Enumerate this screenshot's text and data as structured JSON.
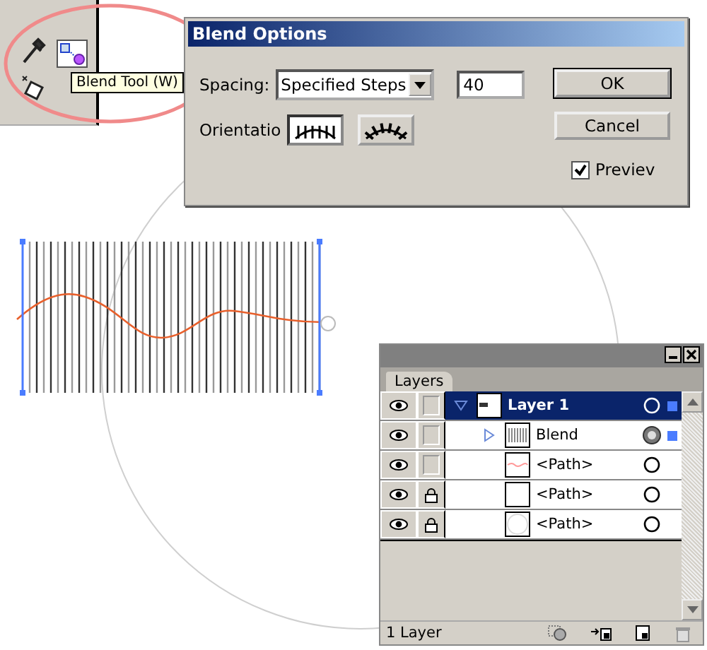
{
  "tooltip": "Blend Tool (W)",
  "dialog": {
    "title": "Blend Options",
    "spacing_label": "Spacing:",
    "spacing_value": "Specified Steps",
    "steps": "40",
    "orientation_label": "Orientatio",
    "orientations": [
      {
        "kind": "page",
        "selected": true
      },
      {
        "kind": "path",
        "selected": false
      }
    ],
    "buttons": [
      "OK",
      "Cancel"
    ],
    "preview": {
      "label": "Previev",
      "checked": true
    }
  },
  "layers_panel": {
    "tab": "Layers",
    "layers": [
      {
        "name": "Layer 1",
        "kind": "layer",
        "current": true,
        "selected": true,
        "appearance": false,
        "locked": false,
        "visible": true,
        "expanded": true,
        "children": [
          {
            "name": "Blend",
            "kind": "blend",
            "current": false,
            "selected": true,
            "appearance": true,
            "locked": false,
            "visible": true,
            "expanded": false
          },
          {
            "name": "<Path>",
            "kind": "wave",
            "current": false,
            "selected": false,
            "appearance": false,
            "locked": false,
            "visible": true
          },
          {
            "name": "<Path>",
            "kind": "rect",
            "current": false,
            "selected": false,
            "appearance": false,
            "locked": true,
            "visible": true
          },
          {
            "name": "<Path>",
            "kind": "circle",
            "current": false,
            "selected": false,
            "appearance": false,
            "locked": true,
            "visible": true
          }
        ]
      }
    ],
    "status": "1 Layer"
  }
}
